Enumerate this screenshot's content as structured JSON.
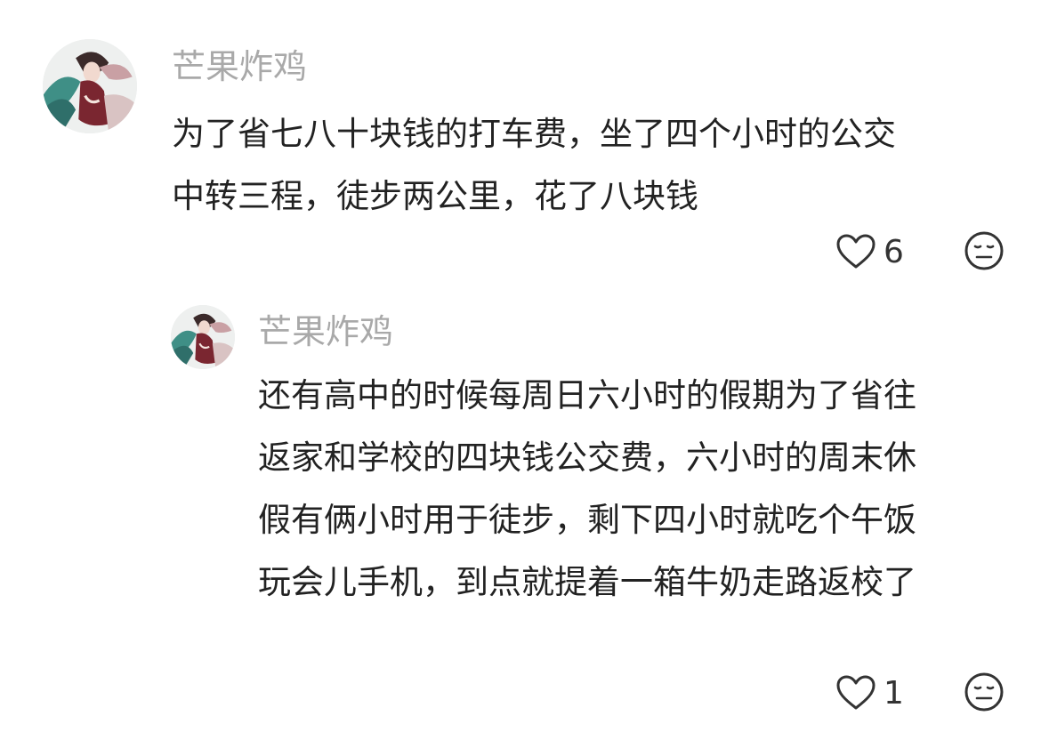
{
  "comments": [
    {
      "username": "芒果炸鸡",
      "avatar_icon": "anime-character-avatar",
      "text_lines": [
        "为了省七八十块钱的打车费，坐了四个小时的公交",
        "中转三程，徒步两公里，花了八块钱"
      ],
      "like_count": "6",
      "like_icon": "heart-outline-icon",
      "reaction_icon": "neutral-face-icon"
    },
    {
      "username": "芒果炸鸡",
      "avatar_icon": "anime-character-avatar",
      "text_lines": [
        "还有高中的时候每周日六小时的假期为了省往",
        "返家和学校的四块钱公交费，六小时的周末休",
        "假有俩小时用于徒步，剩下四小时就吃个午饭",
        "玩会儿手机，到点就提着一箱牛奶走路返校了"
      ],
      "like_count": "1",
      "like_icon": "heart-outline-icon",
      "reaction_icon": "neutral-face-icon"
    }
  ],
  "colors": {
    "username": "#a9a9a9",
    "text": "#222222",
    "icon": "#333333",
    "background": "#ffffff"
  }
}
